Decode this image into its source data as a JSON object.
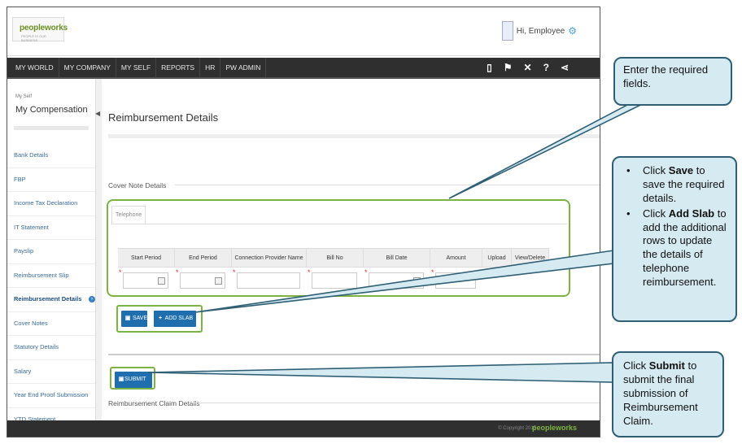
{
  "header": {
    "logo_text": "peopleworks",
    "logo_sub": "PEOPLE IS OUR BUSINESS",
    "user_greeting": "Hi, Employee",
    "gear_icon": "gear-icon"
  },
  "nav": {
    "items": [
      "MY WORLD",
      "MY COMPANY",
      "MY SELF",
      "REPORTS",
      "HR",
      "PW ADMIN"
    ],
    "icons": [
      "book-icon",
      "flag-icon",
      "tools-icon",
      "help-icon",
      "share-icon"
    ]
  },
  "sidebar": {
    "crumb": "My Self",
    "title": "My Compensation",
    "items": [
      {
        "label": "Bank Details"
      },
      {
        "label": "FBP"
      },
      {
        "label": "Income Tax Declaration"
      },
      {
        "label": "IT Statement"
      },
      {
        "label": "Payslip"
      },
      {
        "label": "Reimbursement Slip"
      },
      {
        "label": "Reimbursement Details"
      },
      {
        "label": "Cover Notes"
      },
      {
        "label": "Statutory Details"
      },
      {
        "label": "Salary"
      },
      {
        "label": "Year End Proof Submission"
      },
      {
        "label": "YTD Statement"
      }
    ],
    "active_index": 6
  },
  "main": {
    "page_title": "Reimbursement Details",
    "cover_note_label": "Cover Note Details",
    "tab_label": "Telephone",
    "columns": [
      "Start Period",
      "End Period",
      "Connection Provider Name",
      "Bill No",
      "Bill Date",
      "Amount",
      "Upload",
      "View/Delete"
    ],
    "save_label": "SAVE",
    "add_slab_label": "ADD SLAB",
    "submit_label": "SUBMIT",
    "claim_label": "Reimbursement Claim Details"
  },
  "footer": {
    "copyright": "© Copyright 2015",
    "logo": "peopleworks"
  },
  "callouts": {
    "c1": "Enter the required fields.",
    "c2_b1_pre": "Click ",
    "c2_b1_bold": "Save",
    "c2_b1_post": " to save the required details.",
    "c2_b2_pre": "Click ",
    "c2_b2_bold": "Add Slab",
    "c2_b2_post": " to add the additional rows to update the details of telephone reimbursement.",
    "c3_pre": "Click ",
    "c3_bold": "Submit",
    "c3_post": " to submit the final submission of Reimbursement Claim."
  }
}
